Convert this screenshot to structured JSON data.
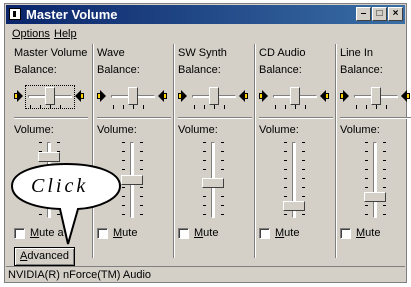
{
  "window": {
    "title": "Master Volume",
    "buttons": [
      "minimize-button",
      "maximize-button",
      "close-button"
    ]
  },
  "menu": [
    "Options",
    "Help"
  ],
  "labels": {
    "balance": "Balance:",
    "volume": "Volume:",
    "mute_prefix": "M",
    "mute_rest": "ute",
    "mute_master_rest": "ute a"
  },
  "panels": [
    {
      "name": "Master Volume",
      "volume_level": 0.85,
      "balance_level": 0.5,
      "muted": false,
      "advanced": "Advanced"
    },
    {
      "name": "Wave",
      "volume_level": 0.5,
      "balance_level": 0.5,
      "muted": false
    },
    {
      "name": "SW Synth",
      "volume_level": 0.45,
      "balance_level": 0.5,
      "muted": false
    },
    {
      "name": "CD Audio",
      "volume_level": 0.1,
      "balance_level": 0.5,
      "muted": false
    },
    {
      "name": "Line In",
      "volume_level": 0.25,
      "balance_level": 0.5,
      "muted": false
    }
  ],
  "callout": {
    "text": "Click"
  },
  "status": "NVIDIA(R) nForce(TM) Audio",
  "colors": {
    "face": "#d4d0c8",
    "title_start": "#0a246a",
    "title_end": "#3a6ea5",
    "speaker": "#ffd200"
  }
}
